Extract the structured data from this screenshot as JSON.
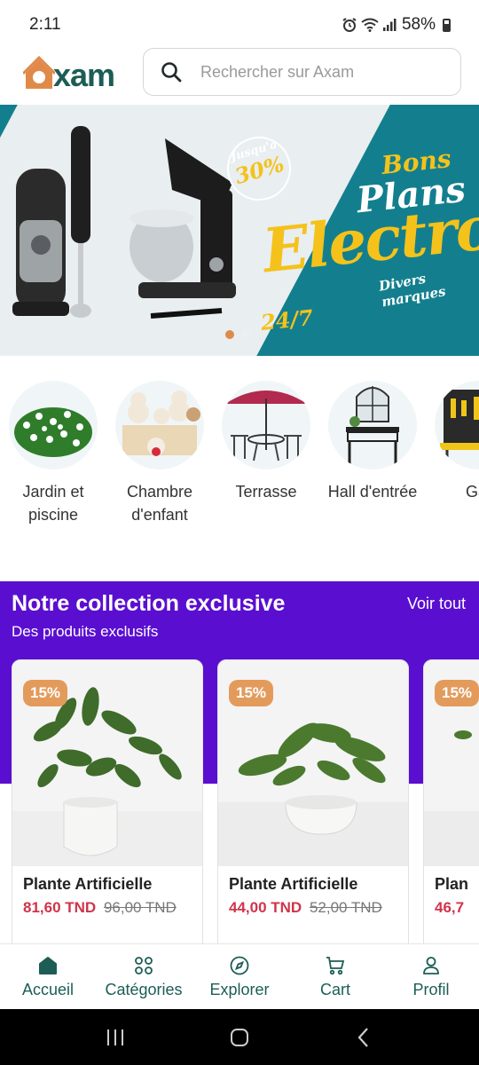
{
  "status_bar": {
    "time": "2:11",
    "battery": "58%",
    "icons": [
      "alarm-icon",
      "wifi-icon",
      "signal-icon",
      "battery-icon"
    ]
  },
  "header": {
    "logo_text": "xam",
    "search_placeholder": "Rechercher sur Axam"
  },
  "banner": {
    "line1": "Bons",
    "line2": "Plans",
    "headline": "Electro",
    "tagline": "Divers marques",
    "discount_prefix": "Jusqu'à",
    "discount_value": "30%",
    "badge_247": "24/7",
    "slide_count": 2,
    "active_slide": 1
  },
  "categories": [
    {
      "label_1": "Jardin et",
      "label_2": "piscine",
      "icon": "garden-icon"
    },
    {
      "label_1": "Chambre",
      "label_2": "d'enfant",
      "icon": "teddy-icon"
    },
    {
      "label_1": "Terrasse",
      "label_2": "",
      "icon": "umbrella-icon"
    },
    {
      "label_1": "Hall d'entrée",
      "label_2": "",
      "icon": "console-icon"
    },
    {
      "label_1": "Gar",
      "label_2": "",
      "icon": "tools-icon"
    }
  ],
  "exclusive": {
    "title": "Notre collection exclusive",
    "see_all": "Voir tout",
    "subtitle": "Des produits exclusifs"
  },
  "products": [
    {
      "badge": "15%",
      "name": "Plante Artificielle",
      "price": "81,60 TND",
      "old_price": "96,00 TND"
    },
    {
      "badge": "15%",
      "name": "Plante Artificielle",
      "price": "44,00 TND",
      "old_price": "52,00 TND"
    },
    {
      "badge": "15%",
      "name": "Plan",
      "price": "46,7",
      "old_price": ""
    }
  ],
  "bottom_nav": [
    {
      "label": "Accueil",
      "icon": "home-icon",
      "active": true
    },
    {
      "label": "Catégories",
      "icon": "grid-icon",
      "active": false
    },
    {
      "label": "Explorer",
      "icon": "compass-icon",
      "active": false
    },
    {
      "label": "Cart",
      "icon": "cart-icon",
      "active": false
    },
    {
      "label": "Profil",
      "icon": "user-icon",
      "active": false
    }
  ],
  "colors": {
    "brand_green": "#1c5d56",
    "brand_orange": "#e08a4a",
    "exclusive_bg": "#5a0fd0",
    "price_red": "#d0344a",
    "banner_teal": "#137f8e"
  }
}
